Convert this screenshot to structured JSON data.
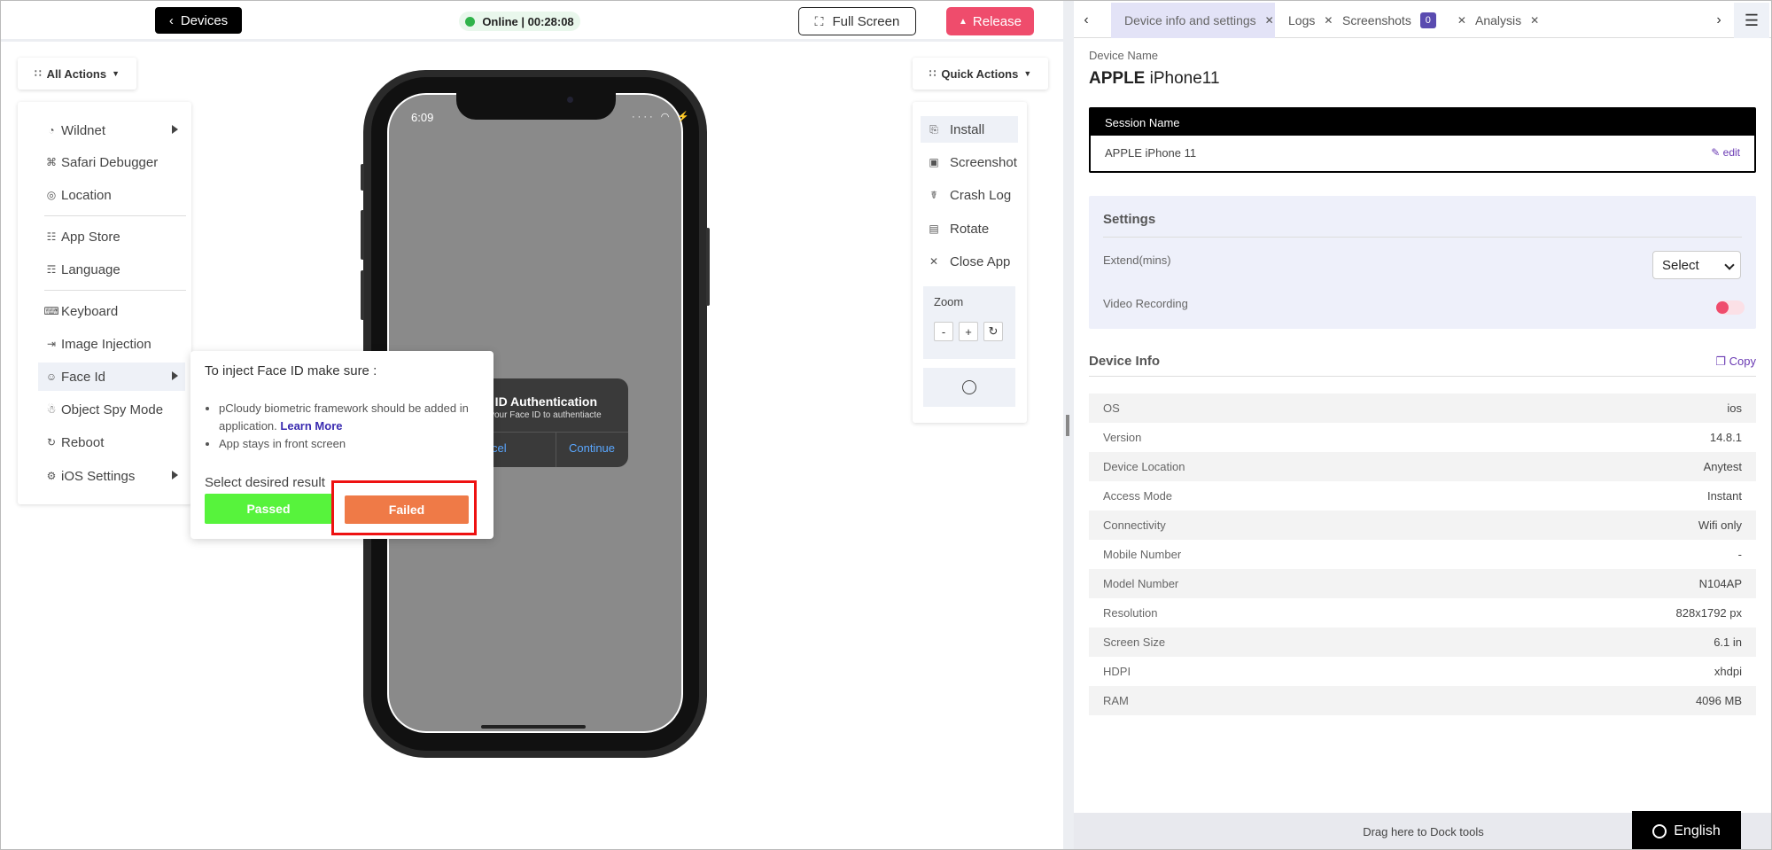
{
  "topbar": {
    "devices_label": "Devices",
    "online_status": "Online | 00:28:08",
    "fullscreen_label": "Full Screen",
    "release_label": "Release"
  },
  "all_actions": {
    "label": "All Actions",
    "items": [
      {
        "label": "Wildnet",
        "icon": "wifi-signal-icon"
      },
      {
        "label": "Safari Debugger",
        "icon": "bug-icon"
      },
      {
        "label": "Location",
        "icon": "location-pin-icon"
      },
      {
        "label": "App Store",
        "icon": "app-grid-icon"
      },
      {
        "label": "Language",
        "icon": "translate-icon"
      },
      {
        "label": "Keyboard",
        "icon": "keyboard-icon"
      },
      {
        "label": "Image Injection",
        "icon": "image-injection-icon"
      },
      {
        "label": "Face Id",
        "icon": "face-id-icon"
      },
      {
        "label": "Object Spy Mode",
        "icon": "spy-icon"
      },
      {
        "label": "Reboot",
        "icon": "reboot-icon"
      },
      {
        "label": "iOS Settings",
        "icon": "settings-gear-icon"
      }
    ]
  },
  "phone": {
    "time": "6:09",
    "faceid_title": "e ID Authentication",
    "faceid_subtitle": "your Face ID to authentiacte",
    "faceid_cancel": "cel",
    "faceid_continue": "Continue"
  },
  "inject_popup": {
    "title": "To inject Face ID make sure :",
    "line1": "pCloudy biometric framework should be added in application.",
    "learn_more": "Learn More",
    "line2": "App stays in front screen",
    "select_label": "Select desired result",
    "passed_label": "Passed",
    "failed_label": "Failed"
  },
  "quick_actions": {
    "label": "Quick Actions",
    "items": [
      {
        "label": "Install",
        "icon": "install-icon"
      },
      {
        "label": "Screenshot",
        "icon": "screenshot-icon"
      },
      {
        "label": "Crash Log",
        "icon": "crash-log-icon"
      },
      {
        "label": "Rotate",
        "icon": "rotate-icon"
      },
      {
        "label": "Close App",
        "icon": "close-icon"
      }
    ],
    "zoom_label": "Zoom",
    "zoom_minus": "-",
    "zoom_plus": "+"
  },
  "tabs": {
    "device": "Device info and settings",
    "logs": "Logs",
    "screenshots": "Screenshots",
    "screenshots_count": "0",
    "analysis": "Analysis"
  },
  "device": {
    "name_label": "Device Name",
    "name_brand": "APPLE",
    "name_model": "iPhone11",
    "session_label": "Session Name",
    "session_value": "APPLE iPhone 11",
    "edit_label": "edit"
  },
  "settings": {
    "title": "Settings",
    "extend_label": "Extend(mins)",
    "extend_value": "Select",
    "video_label": "Video Recording"
  },
  "device_info": {
    "title": "Device Info",
    "copy_label": "Copy",
    "rows": [
      {
        "k": "OS",
        "v": "ios"
      },
      {
        "k": "Version",
        "v": "14.8.1"
      },
      {
        "k": "Device Location",
        "v": "Anytest"
      },
      {
        "k": "Access Mode",
        "v": "Instant"
      },
      {
        "k": "Connectivity",
        "v": "Wifi only"
      },
      {
        "k": "Mobile Number",
        "v": "-"
      },
      {
        "k": "Model Number",
        "v": "N104AP"
      },
      {
        "k": "Resolution",
        "v": "828x1792 px"
      },
      {
        "k": "Screen Size",
        "v": "6.1 in"
      },
      {
        "k": "HDPI",
        "v": "xhdpi"
      },
      {
        "k": "RAM",
        "v": "4096 MB"
      }
    ]
  },
  "footer": {
    "dock_label": "Drag here to Dock tools",
    "language": "English"
  },
  "colors": {
    "release": "#ef4c6c",
    "passed": "#57f33c",
    "failed": "#ef7a47",
    "highlight": "#e11111",
    "accent": "#6a3ab3"
  }
}
